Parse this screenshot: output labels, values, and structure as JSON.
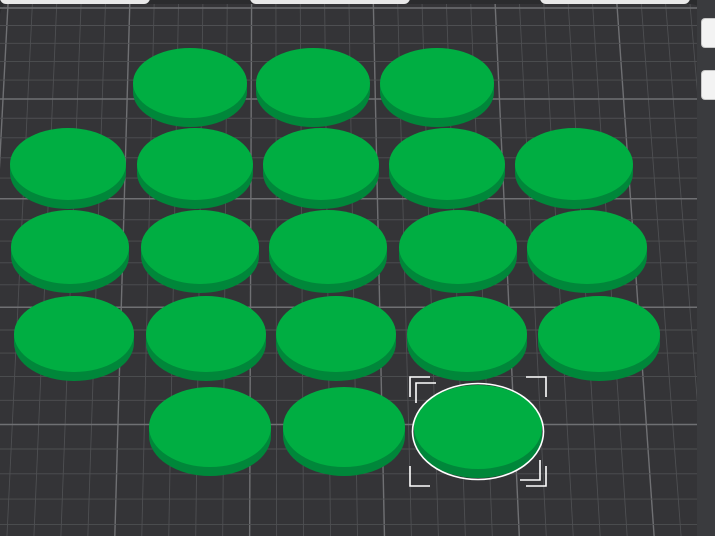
{
  "scene": {
    "colors": {
      "background": "#2b2c2e",
      "bed": "#343437",
      "grid_line": "#6f7073",
      "grid_minor": "#4e4f52",
      "part_top": "#00ae42",
      "part_side": "#00873a",
      "selection": "#ffffff"
    },
    "objects": [
      {
        "name": "disc",
        "selected": false
      },
      {
        "name": "disc",
        "selected": false
      },
      {
        "name": "disc",
        "selected": false
      },
      {
        "name": "disc",
        "selected": false
      },
      {
        "name": "disc",
        "selected": false
      },
      {
        "name": "disc",
        "selected": false
      },
      {
        "name": "disc",
        "selected": false
      },
      {
        "name": "disc",
        "selected": false
      },
      {
        "name": "disc",
        "selected": false
      },
      {
        "name": "disc",
        "selected": false
      },
      {
        "name": "disc",
        "selected": false
      },
      {
        "name": "disc",
        "selected": false
      },
      {
        "name": "disc",
        "selected": false
      },
      {
        "name": "disc",
        "selected": false
      },
      {
        "name": "disc",
        "selected": false
      },
      {
        "name": "disc",
        "selected": false
      },
      {
        "name": "disc",
        "selected": false
      },
      {
        "name": "disc",
        "selected": false
      },
      {
        "name": "disc",
        "selected": false
      },
      {
        "name": "disc",
        "selected": false
      },
      {
        "name": "disc",
        "selected": true
      }
    ],
    "object_count": 21,
    "selected_index": 20
  },
  "panel": {
    "buttons": [
      "panel-button",
      "panel-button"
    ]
  }
}
